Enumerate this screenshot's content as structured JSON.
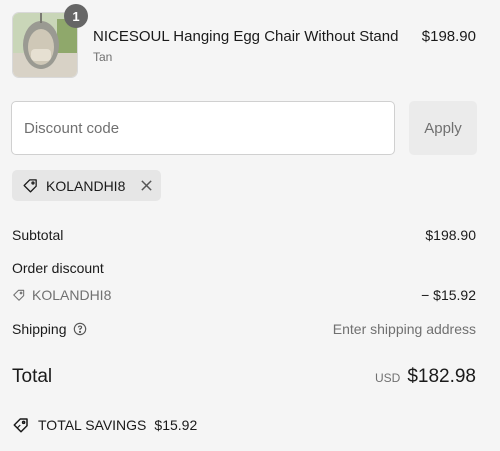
{
  "product": {
    "title": "NICESOUL Hanging Egg Chair Without Stand",
    "variant": "Tan",
    "price": "$198.90",
    "quantity": "1",
    "image_icon": "egg-chair-photo"
  },
  "discount": {
    "placeholder": "Discount code",
    "value": "",
    "apply_label": "Apply",
    "applied_code": "KOLANDHI8"
  },
  "summary": {
    "subtotal_label": "Subtotal",
    "subtotal_value": "$198.90",
    "order_discount_label": "Order discount",
    "discount_code": "KOLANDHI8",
    "discount_value": "− $15.92",
    "shipping_label": "Shipping",
    "shipping_value": "Enter shipping address",
    "total_label": "Total",
    "currency": "USD",
    "total_value": "$182.98",
    "savings_label": "TOTAL SAVINGS",
    "savings_value": "$15.92"
  },
  "colors": {
    "background": "#f5f5f5",
    "muted_text": "#707070",
    "badge": "#666666",
    "chip": "#e6e6e6"
  }
}
